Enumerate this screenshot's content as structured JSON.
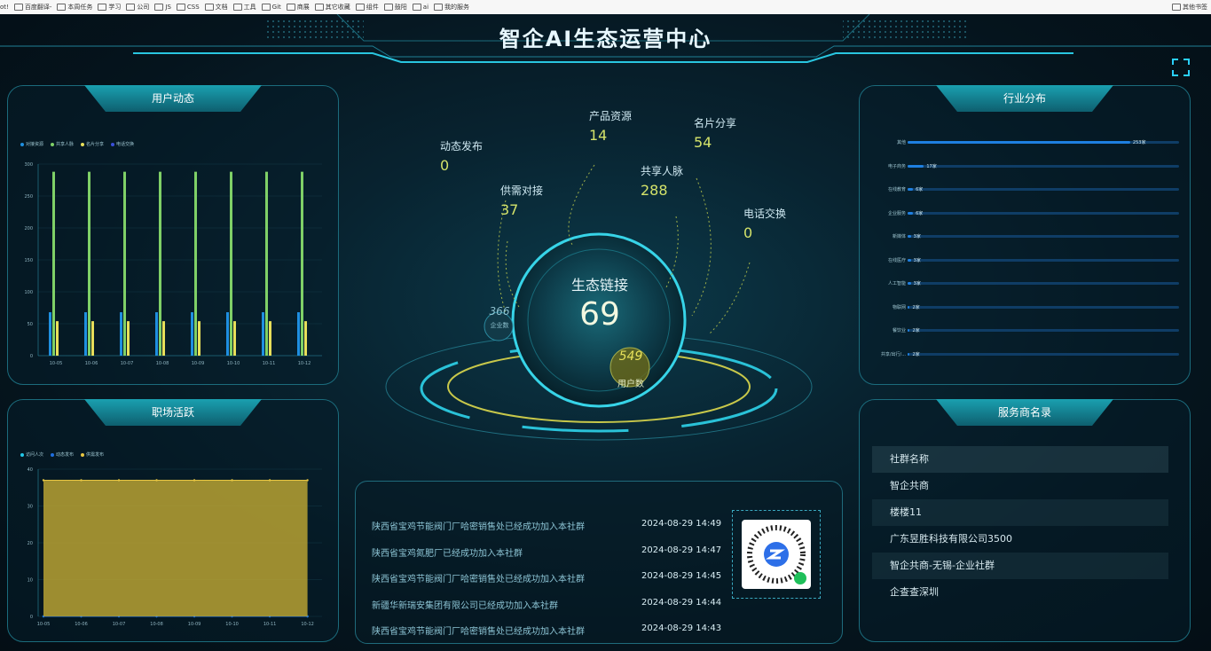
{
  "bookmarks": {
    "left_cut": "ot!",
    "items": [
      "百度翻译-",
      "本周任务",
      "学习",
      "公司",
      "JS",
      "CSS",
      "文档",
      "工具",
      "Git",
      "商展",
      "其它收藏",
      "组件",
      "鼓阳",
      "ai",
      "我的服务"
    ],
    "right": "其他书签"
  },
  "header": {
    "title": "智企AI生态运营中心"
  },
  "panels": {
    "user_activity": {
      "title": "用户动态",
      "legend": [
        "对接资源",
        "共享人脉",
        "名片分享",
        "电话交换"
      ],
      "y_ticks": [
        "300",
        "250",
        "200",
        "150",
        "100",
        "50",
        "0"
      ],
      "x_ticks": [
        "10-05",
        "10-06",
        "10-07",
        "10-08",
        "10-09",
        "10-10",
        "10-11",
        "10-12"
      ]
    },
    "workplace": {
      "title": "职场活跃",
      "legend": [
        "访问人次",
        "动态发布",
        "供需发布"
      ],
      "y_ticks": [
        "40",
        "30",
        "20",
        "10",
        "0"
      ],
      "x_ticks": [
        "10-05",
        "10-06",
        "10-07",
        "10-08",
        "10-09",
        "10-10",
        "10-11",
        "10-12"
      ]
    },
    "industry": {
      "title": "行业分布",
      "rows": [
        {
          "label": "其他",
          "value_text": "253家",
          "frac": 0.82
        },
        {
          "label": "电子商务",
          "value_text": "17家",
          "frac": 0.06
        },
        {
          "label": "在线教育",
          "value_text": "6家",
          "frac": 0.02
        },
        {
          "label": "企业服务",
          "value_text": "6家",
          "frac": 0.02
        },
        {
          "label": "新媒体",
          "value_text": "3家",
          "frac": 0.012
        },
        {
          "label": "在线医疗",
          "value_text": "3家",
          "frac": 0.012
        },
        {
          "label": "人工智能",
          "value_text": "3家",
          "frac": 0.012
        },
        {
          "label": "物联网",
          "value_text": "2家",
          "frac": 0.008
        },
        {
          "label": "餐饮业",
          "value_text": "2家",
          "frac": 0.008
        },
        {
          "label": "共享/出行/...",
          "value_text": "2家",
          "frac": 0.008
        }
      ]
    },
    "services": {
      "title": "服务商名录",
      "header": "社群名称",
      "items": [
        "智企共商",
        "楼楼11",
        "广东昱胜科技有限公司3500",
        "智企共商-无锡-企业社群",
        "企查查深圳"
      ]
    }
  },
  "center": {
    "hub_label": "生态链接",
    "hub_value": "69",
    "enterprise_value": "366",
    "enterprise_label": "企业数",
    "user_value": "549",
    "user_label": "用户数",
    "stats": [
      {
        "label": "动态发布",
        "value": "0"
      },
      {
        "label": "供需对接",
        "value": "37"
      },
      {
        "label": "产品资源",
        "value": "14"
      },
      {
        "label": "共享人脉",
        "value": "288"
      },
      {
        "label": "名片分享",
        "value": "54"
      },
      {
        "label": "电话交换",
        "value": "0"
      }
    ]
  },
  "news": [
    {
      "text": "陕西省宝鸡节能阀门厂哈密销售处已经成功加入本社群",
      "time": "2024-08-29 14:49"
    },
    {
      "text": "陕西省宝鸡氮肥厂已经成功加入本社群",
      "time": "2024-08-29 14:47"
    },
    {
      "text": "陕西省宝鸡节能阀门厂哈密销售处已经成功加入本社群",
      "time": "2024-08-29 14:45"
    },
    {
      "text": "新疆华新瑞安集团有限公司已经成功加入本社群",
      "time": "2024-08-29 14:44"
    },
    {
      "text": "陕西省宝鸡节能阀门厂哈密销售处已经成功加入本社群",
      "time": "2024-08-29 14:43"
    }
  ],
  "chart_data": [
    {
      "type": "bar",
      "categories": [
        "10-05",
        "10-06",
        "10-07",
        "10-08",
        "10-09",
        "10-10",
        "10-11",
        "10-12"
      ],
      "series": [
        {
          "name": "对接资源",
          "values": [
            68,
            68,
            68,
            68,
            68,
            68,
            68,
            68
          ]
        },
        {
          "name": "共享人脉",
          "values": [
            288,
            288,
            288,
            288,
            288,
            288,
            288,
            288
          ]
        },
        {
          "name": "名片分享",
          "values": [
            54,
            54,
            54,
            54,
            54,
            54,
            54,
            54
          ]
        },
        {
          "name": "电话交换",
          "values": [
            0,
            0,
            0,
            0,
            0,
            0,
            0,
            0
          ]
        }
      ],
      "ylim": [
        0,
        300
      ],
      "colors": [
        "#1f8fe0",
        "#7fd067",
        "#e8df5a",
        "#3a4fd8"
      ]
    },
    {
      "type": "area",
      "categories": [
        "10-05",
        "10-06",
        "10-07",
        "10-08",
        "10-09",
        "10-10",
        "10-11",
        "10-12"
      ],
      "series": [
        {
          "name": "访问人次",
          "values": [
            0,
            0,
            0,
            0,
            0,
            0,
            0,
            0
          ]
        },
        {
          "name": "动态发布",
          "values": [
            0,
            0,
            0,
            0,
            0,
            0,
            0,
            0
          ]
        },
        {
          "name": "供需发布",
          "values": [
            37,
            37,
            37,
            37,
            37,
            37,
            37,
            37
          ]
        }
      ],
      "ylim": [
        0,
        40
      ],
      "colors": [
        "#22c7e8",
        "#1f6fe0",
        "#e8c642"
      ]
    }
  ]
}
